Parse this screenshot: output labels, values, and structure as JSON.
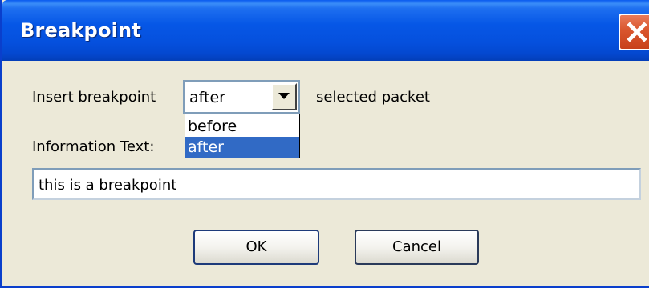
{
  "window": {
    "title": "Breakpoint"
  },
  "form": {
    "insert_label": "Insert breakpoint",
    "position_select": {
      "selected": "after",
      "options": [
        "before",
        "after"
      ],
      "highlighted": "after"
    },
    "suffix_label": "selected packet",
    "info_label": "Information Text:",
    "info_value": "this is a breakpoint"
  },
  "buttons": {
    "ok": "OK",
    "cancel": "Cancel"
  },
  "colors": {
    "titlebar": "#0657e6",
    "dialog_bg": "#ece9d8",
    "selection": "#316ac5",
    "close_button": "#d9552d"
  },
  "icons": {
    "close": "close-icon",
    "dropdown_arrow": "chevron-down-icon"
  }
}
